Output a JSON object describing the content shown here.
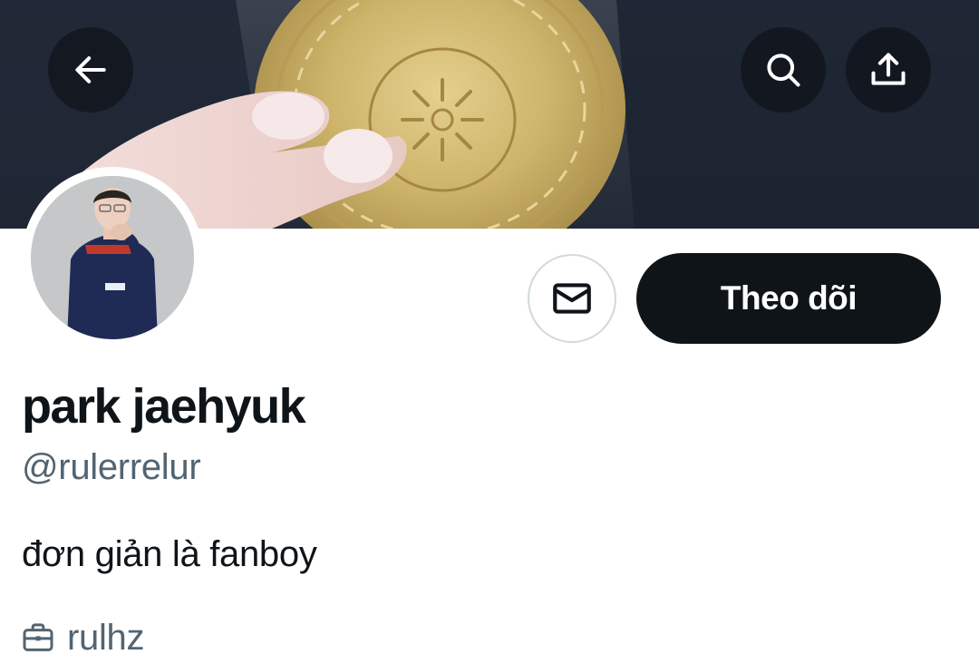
{
  "header": {
    "back_icon": "arrow-left-icon",
    "search_icon": "search-icon",
    "share_icon": "share-upload-icon"
  },
  "profile": {
    "display_name": "park jaehyuk",
    "handle": "@rulerrelur",
    "bio": "đơn giản là fanboy",
    "profession": "rulhz",
    "profession_icon": "briefcase-icon"
  },
  "actions": {
    "message_icon": "envelope-icon",
    "follow_label": "Theo dõi"
  },
  "colors": {
    "primary_text": "#0f1419",
    "secondary_text": "#536471",
    "follow_button_bg": "#0f1419",
    "follow_button_text": "#ffffff",
    "border": "#cfd9de"
  }
}
